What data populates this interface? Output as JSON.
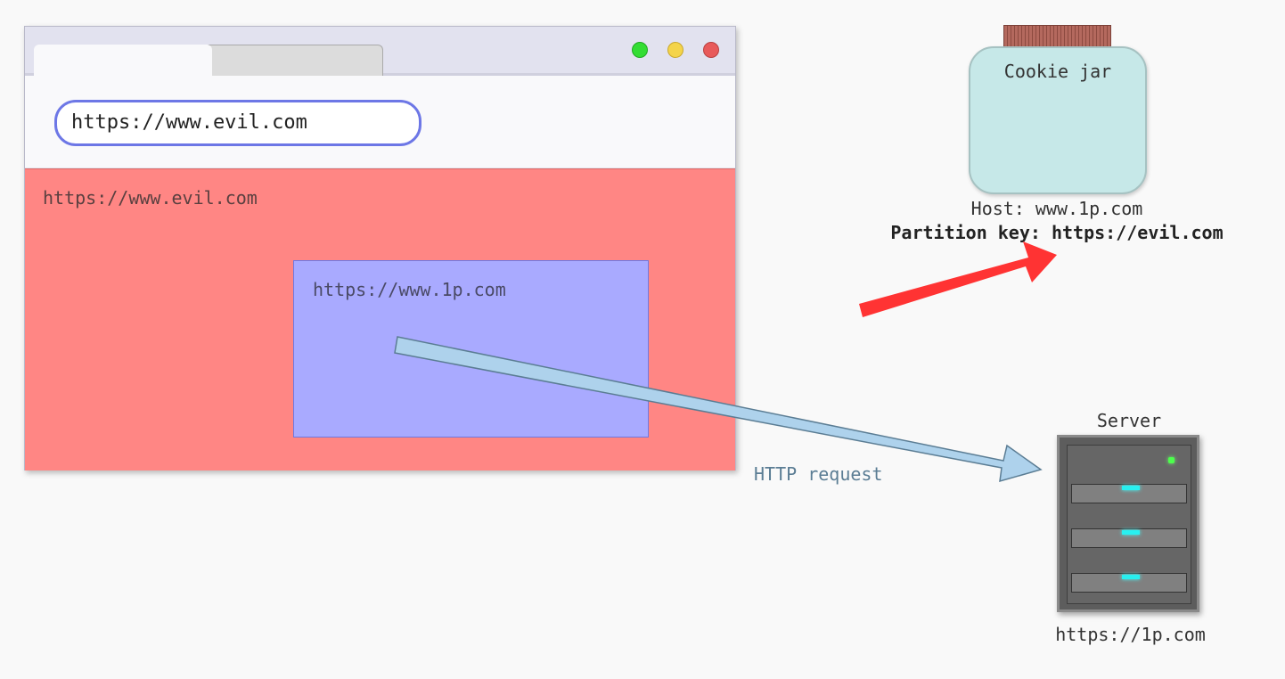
{
  "browser": {
    "address_bar": "https://www.evil.com",
    "window_buttons": {
      "maximize_color": "#33dd33",
      "minimize_color": "#f4d44a",
      "close_color": "#e85a5a"
    },
    "page": {
      "origin": "https://www.evil.com",
      "background": "#ff8684",
      "iframe": {
        "origin": "https://www.1p.com",
        "background": "#a9aaff"
      }
    }
  },
  "cookie_jar": {
    "title": "Cookie jar",
    "host": "Host: www.1p.com",
    "partition_key": "Partition key: https://evil.com"
  },
  "request": {
    "label": "HTTP request",
    "arrow_color": "#aed2ec"
  },
  "write_arrow_color": "#ff3333",
  "server": {
    "title": "Server",
    "url": "https://1p.com"
  }
}
